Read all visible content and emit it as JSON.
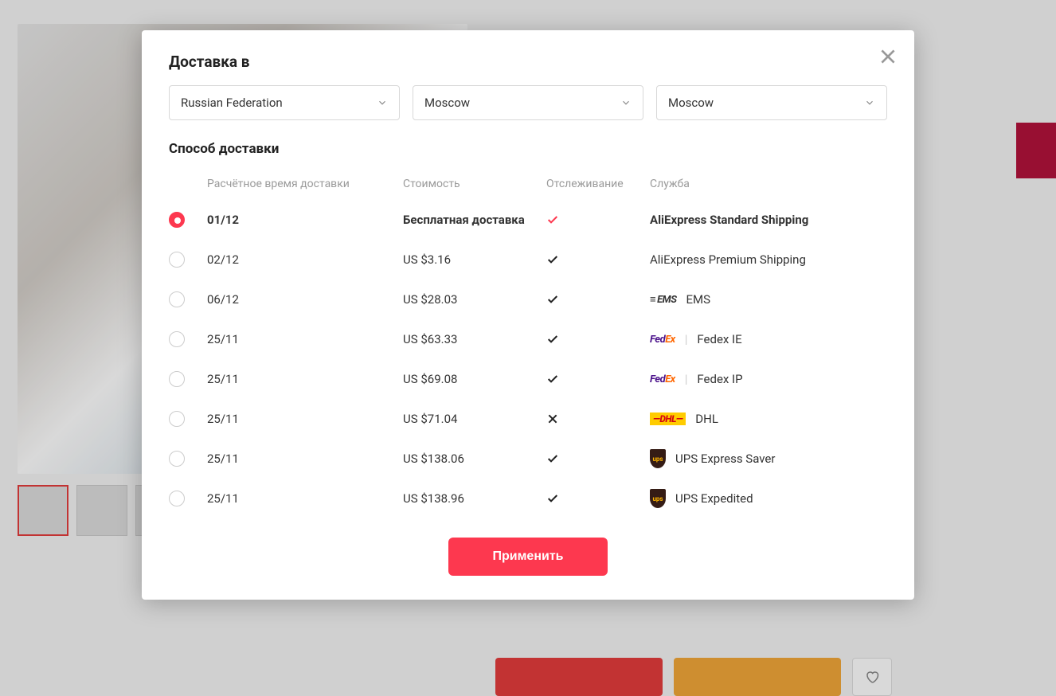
{
  "modal": {
    "title": "Доставка в",
    "close_icon": "close",
    "selects": {
      "country": "Russian Federation",
      "region": "Moscow",
      "city": "Moscow"
    },
    "shipping_section": "Способ доставки",
    "headers": {
      "date": "Расчётное время доставки",
      "cost": "Стоимость",
      "tracking": "Отслеживание",
      "service": "Служба"
    },
    "options": [
      {
        "date": "01/12",
        "cost": "Бесплатная доставка",
        "tracking": "yes",
        "service": "AliExpress Standard Shipping",
        "logo": "none",
        "selected": true
      },
      {
        "date": "02/12",
        "cost": "US $3.16",
        "tracking": "yes",
        "service": "AliExpress Premium Shipping",
        "logo": "none",
        "selected": false
      },
      {
        "date": "06/12",
        "cost": "US $28.03",
        "tracking": "yes",
        "service": "EMS",
        "logo": "ems",
        "selected": false
      },
      {
        "date": "25/11",
        "cost": "US $63.33",
        "tracking": "yes",
        "service": "Fedex IE",
        "logo": "fedex",
        "selected": false
      },
      {
        "date": "25/11",
        "cost": "US $69.08",
        "tracking": "yes",
        "service": "Fedex IP",
        "logo": "fedex",
        "selected": false
      },
      {
        "date": "25/11",
        "cost": "US $71.04",
        "tracking": "no",
        "service": "DHL",
        "logo": "dhl",
        "selected": false
      },
      {
        "date": "25/11",
        "cost": "US $138.06",
        "tracking": "yes",
        "service": "UPS Express Saver",
        "logo": "ups",
        "selected": false
      },
      {
        "date": "25/11",
        "cost": "US $138.96",
        "tracking": "yes",
        "service": "UPS Expedited",
        "logo": "ups",
        "selected": false
      }
    ],
    "apply_button": "Применить"
  }
}
